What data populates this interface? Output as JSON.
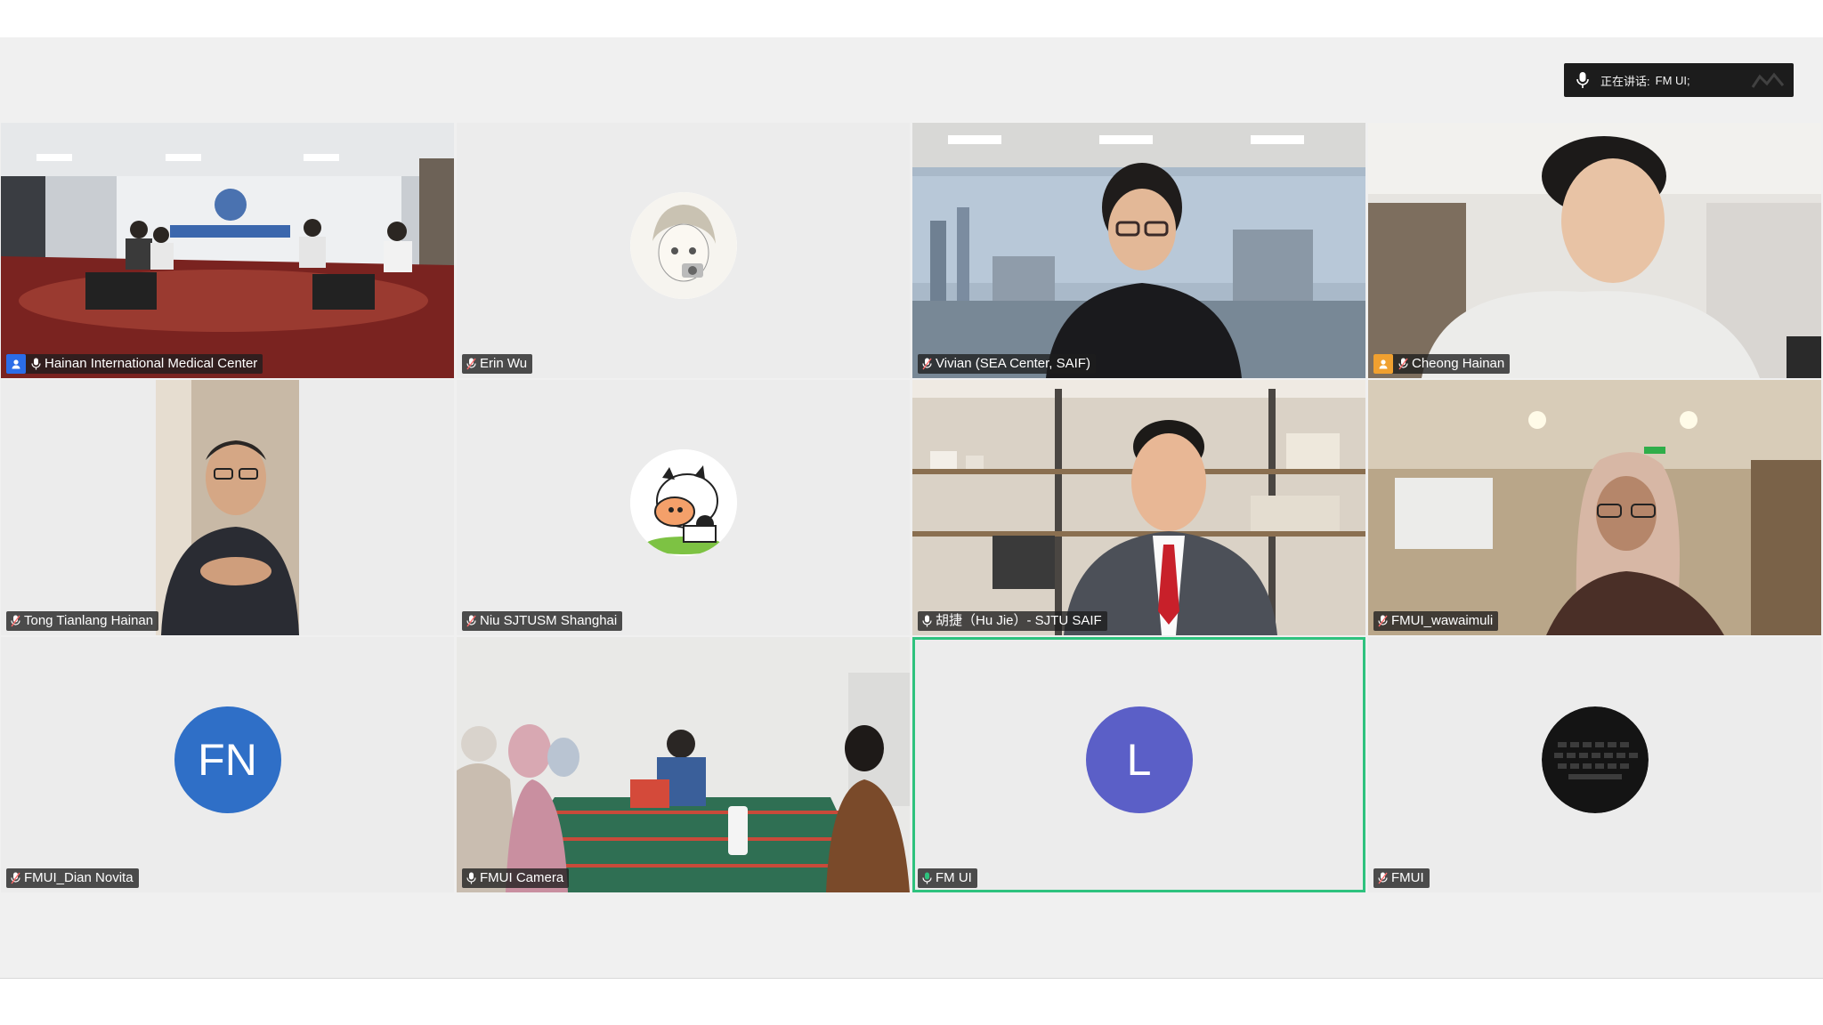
{
  "speaking": {
    "label": "正在讲话:",
    "name": "FM UI;"
  },
  "colors": {
    "active_border": "#2ec27e",
    "host_blue": "#2b6de8",
    "host_orange": "#f0a030",
    "avatar_fn": "#2f6fc7",
    "avatar_l": "#5b5fc7"
  },
  "tiles": [
    {
      "name": "Hainan International Medical Center",
      "role_icon": "host-icon"
    },
    {
      "name": "Erin Wu"
    },
    {
      "name": "Vivian (SEA Center, SAIF)"
    },
    {
      "name": "Cheong Hainan",
      "role_icon": "cohost-icon"
    },
    {
      "name": "Tong Tianlang Hainan"
    },
    {
      "name": "Niu SJTUSM Shanghai"
    },
    {
      "name": "胡捷（Hu Jie）- SJTU SAIF"
    },
    {
      "name": "FMUI_wawaimuli"
    },
    {
      "name": "FMUI_Dian Novita",
      "avatar_initials": "FN"
    },
    {
      "name": "FMUI Camera"
    },
    {
      "name": "FM UI",
      "avatar_initials": "L",
      "active": true
    },
    {
      "name": "FMUI"
    }
  ]
}
